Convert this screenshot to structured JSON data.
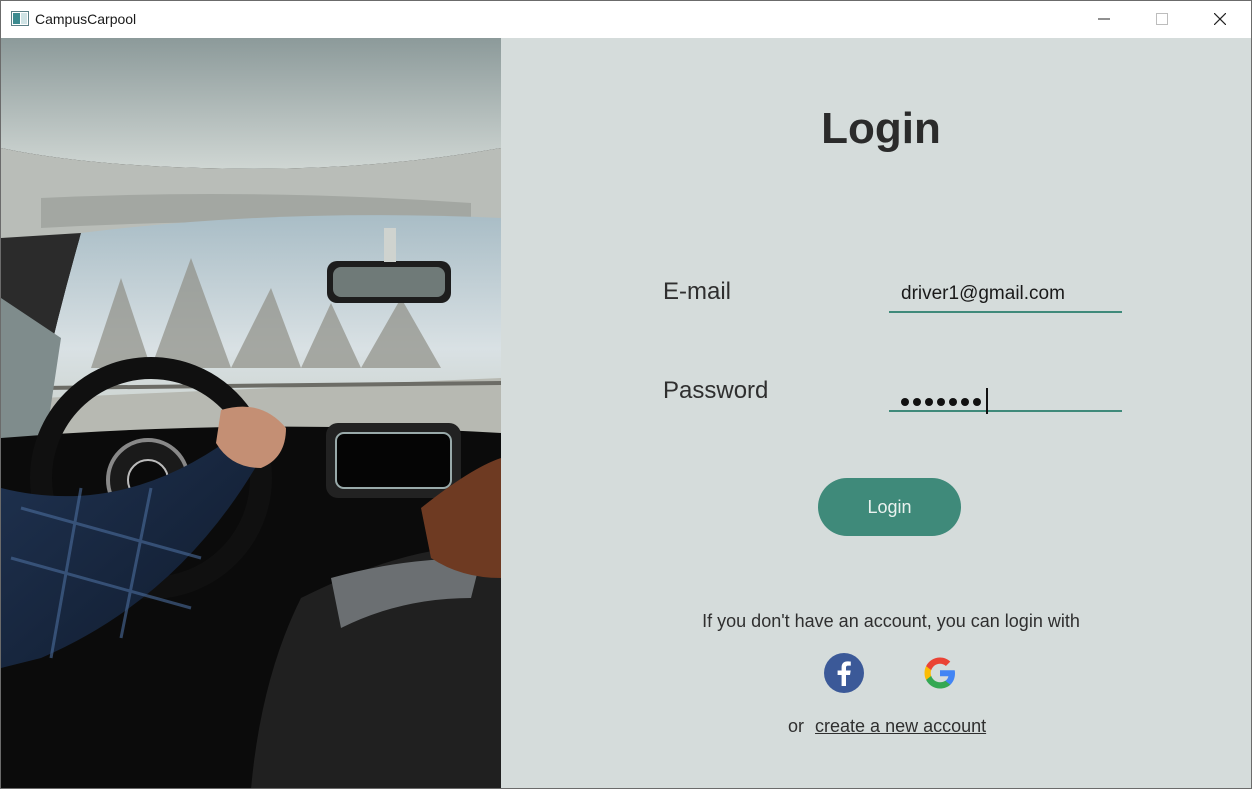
{
  "window": {
    "title": "CampusCarpool",
    "controls": [
      "minimize",
      "maximize",
      "close"
    ]
  },
  "hero_image": {
    "description_icon": "car-interior-photo"
  },
  "login": {
    "heading": "Login",
    "email": {
      "label": "E-mail",
      "value": "driver1@gmail.com"
    },
    "password": {
      "label": "Password",
      "masked_length": 7
    },
    "submit_label": "Login",
    "alt_prompt": "If you don't have an account, you can login with",
    "social": [
      {
        "name": "facebook",
        "icon": "facebook-icon",
        "color": "#3b5998"
      },
      {
        "name": "google",
        "icon": "google-icon"
      }
    ],
    "signup_prefix": "or",
    "signup_link": "create a new account"
  },
  "colors": {
    "accent": "#3f8a7a",
    "panel_bg": "#d5dcdb"
  }
}
